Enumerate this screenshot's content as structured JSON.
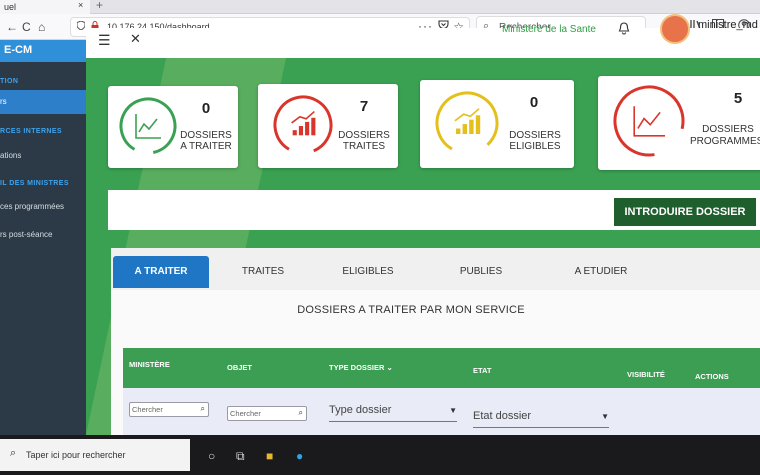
{
  "browser": {
    "tab_title": "uel",
    "tab_close": "×",
    "new_tab": "+",
    "back_icon": "←",
    "reload_icon": "C",
    "home_icon": "⌂",
    "url": "10.176.24.150/dashboard",
    "more_icon": "···",
    "search_placeholder": "Rechercher"
  },
  "app": {
    "brand": "E-CM",
    "ministry_name": "Ministere de la Sante",
    "username": "ministre_md"
  },
  "sidebar": {
    "section_1": "TION",
    "item_active": "rs",
    "section_2": "RCES INTERNES",
    "item_2": "ations",
    "section_3": "IL DES MINISTRES",
    "item_3": "ces programmées",
    "item_4": "rs post-séance"
  },
  "cards": [
    {
      "count": "0",
      "label_1": "DOSSIERS",
      "label_2": "A TRAITER",
      "color": "#3aa152",
      "icon": "chart-line-icon"
    },
    {
      "count": "7",
      "label_1": "DOSSIERS",
      "label_2": "TRAITES",
      "color": "#d9362b",
      "icon": "bar-chart-up-icon"
    },
    {
      "count": "0",
      "label_1": "DOSSIERS",
      "label_2": "ELIGIBLES",
      "color": "#e3c01c",
      "icon": "bar-chart-up-icon"
    },
    {
      "count": "5",
      "label_1": "DOSSIERS",
      "label_2": "PROGRAMMES",
      "color": "#d9362b",
      "icon": "chart-line-icon"
    }
  ],
  "action_button": "INTRODUIRE DOSSIER",
  "tabs": [
    {
      "label": "A TRAITER",
      "active": true
    },
    {
      "label": "TRAITES",
      "active": false
    },
    {
      "label": "ELIGIBLES",
      "active": false
    },
    {
      "label": "PUBLIES",
      "active": false
    },
    {
      "label": "A ETUDIER",
      "active": false
    }
  ],
  "panel_title": "DOSSIERS A TRAITER PAR MON SERVICE",
  "table": {
    "col_ministere": "MINISTÈRE",
    "col_objet": "OBJET",
    "col_type": "TYPE DOSSIER",
    "col_type_caret": "⌄",
    "col_etat": "ETAT",
    "col_visibilite": "VISIBILITÉ",
    "col_actions": "ACTIONS"
  },
  "filters": {
    "ministere_placeholder": "Chercher",
    "objet_placeholder": "Chercher",
    "type_value": "Type dossier",
    "etat_value": "Etat dossier"
  },
  "taskbar": {
    "search_placeholder": "Taper ici pour rechercher"
  },
  "colors": {
    "primary_green": "#3aa152",
    "dark_green": "#1f5e2d",
    "accent_blue": "#1f76c5",
    "sidebar": "#2b3a46"
  }
}
